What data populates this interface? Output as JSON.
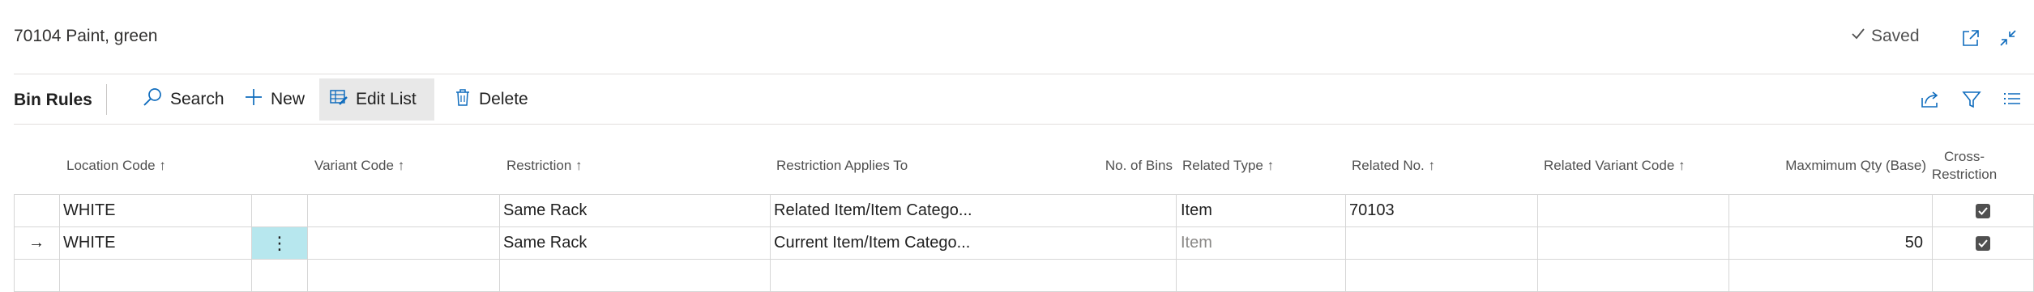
{
  "header": {
    "title": "70104 Paint, green",
    "saved_label": "Saved"
  },
  "actions": {
    "page_name": "Bin Rules",
    "search": "Search",
    "new": "New",
    "edit_list": "Edit List",
    "delete": "Delete"
  },
  "columns": {
    "location_code": "Location Code",
    "variant_code": "Variant Code",
    "restriction": "Restriction",
    "restriction_applies_to": "Restriction Applies To",
    "no_of_bins": "No. of Bins",
    "related_type": "Related Type",
    "related_no": "Related No.",
    "related_variant_code": "Related Variant Code",
    "maximum_qty": "Maxmimum Qty (Base)",
    "cross_restriction_1": "Cross-",
    "cross_restriction_2": "Restriction"
  },
  "sort_arrow": "↑",
  "rows": [
    {
      "location_code": "WHITE",
      "variant_code": "",
      "restriction": "Same Rack",
      "restriction_applies_to": "Related Item/Item Catego...",
      "no_of_bins": "",
      "related_type": "Item",
      "related_no": "70103",
      "related_variant_code": "",
      "maximum_qty": "",
      "cross_restriction": true
    },
    {
      "indicator": "→",
      "menu": "⋮",
      "location_code": "WHITE",
      "variant_code": "",
      "restriction": "Same Rack",
      "restriction_applies_to": "Current Item/Item Catego...",
      "no_of_bins": "",
      "related_type": "Item",
      "related_no": "",
      "related_variant_code": "",
      "maximum_qty": "50",
      "cross_restriction": true
    }
  ],
  "colors": {
    "accent": "#0f6cbd",
    "selected_cell": "#b7e7ee",
    "border": "#d6d6d6"
  }
}
